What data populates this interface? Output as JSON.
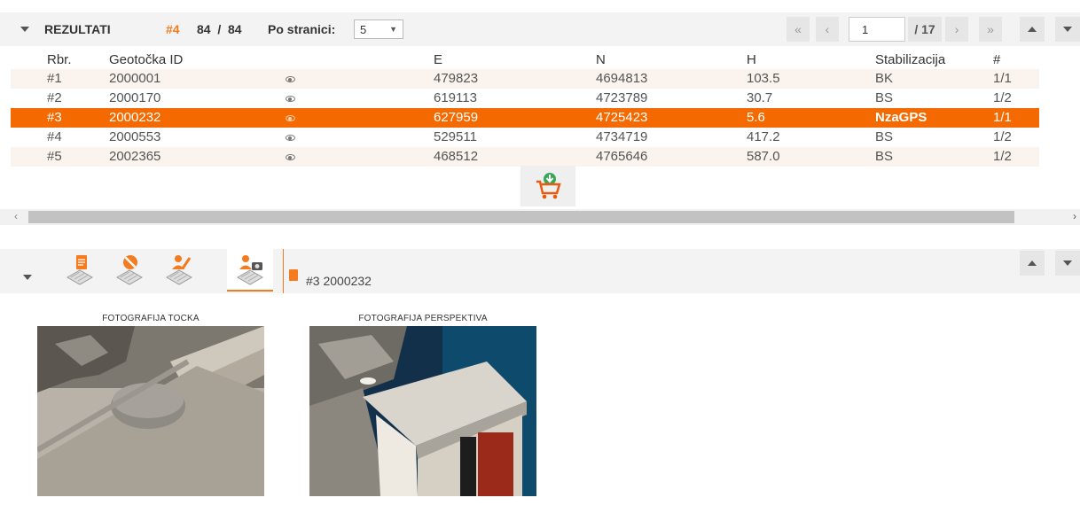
{
  "results": {
    "title": "REZULTATI",
    "selected": "#4",
    "counts": "84  /  84",
    "per_page_label": "Po stranici:",
    "per_page_value": "5",
    "page_current": "1",
    "page_total": "/ 17"
  },
  "pager": {
    "first": "«",
    "prev": "‹",
    "next": "›",
    "last": "»"
  },
  "table": {
    "columns": [
      "Rbr.",
      "Geotočka ID",
      "E",
      "N",
      "H",
      "Stabilizacija",
      "#"
    ],
    "rows": [
      [
        "#1",
        "2000001",
        "479823",
        "4694813",
        "103.5",
        "BK",
        "1/1"
      ],
      [
        "#2",
        "2000170",
        "619113",
        "4723789",
        "30.7",
        "BS",
        "1/2"
      ],
      [
        "#3",
        "2000232",
        "627959",
        "4725423",
        "5.6",
        "NzaGPS",
        "1/1"
      ],
      [
        "#4",
        "2000553",
        "529511",
        "4734719",
        "417.2",
        "BS",
        "1/2"
      ],
      [
        "#5",
        "2002365",
        "468512",
        "4765646",
        "587.0",
        "BS",
        "1/2"
      ]
    ],
    "selected_row": 2
  },
  "scroll": {
    "left": "‹",
    "right": "›"
  },
  "detail": {
    "breadcrumb": "#3 2000232",
    "tabs": [
      "document-map-icon",
      "forbidden-map-icon",
      "surveyor-map-icon",
      "camera-map-icon"
    ],
    "active_tab": 3
  },
  "photos": [
    {
      "caption": "FOTOGRAFIJA TOCKA"
    },
    {
      "caption": "FOTOGRAFIJA PERSPEKTIVA"
    }
  ],
  "colors": {
    "accent": "#f47b20",
    "selected_row": "#f46a00",
    "toolbar": "#f3f3f3"
  }
}
